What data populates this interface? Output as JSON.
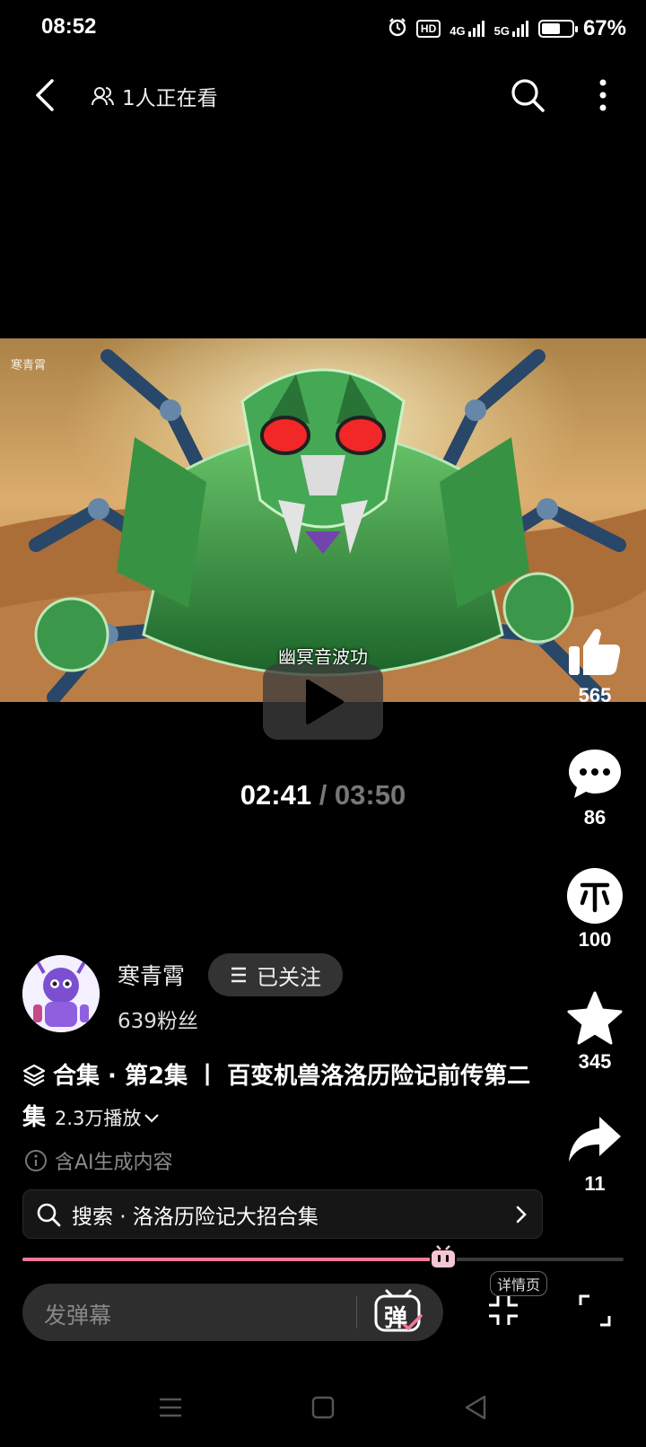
{
  "status_bar": {
    "time": "08:52",
    "hd_label": "HD",
    "net1": "4G",
    "net2": "5G",
    "battery_percent": "67%",
    "battery_level": 0.67
  },
  "nav": {
    "watching": "1人正在看"
  },
  "video": {
    "watermark": "寒青霄",
    "subtitle": "幽冥音波功",
    "current_time": "02:41",
    "separator": " / ",
    "total_time": "03:50",
    "progress": 0.7
  },
  "actions": {
    "like_count": "565",
    "comment_count": "86",
    "coin_count": "100",
    "favorite_count": "345",
    "share_count": "11"
  },
  "uploader": {
    "name": "寒青霄",
    "follow_label": "已关注",
    "fans": "639粉丝"
  },
  "video_info": {
    "title": "合集 · 第2集 丨 百变机兽洛洛历险记前传第二集",
    "plays": "2.3万播放",
    "ai_note": "含AI生成内容"
  },
  "search": {
    "label": "搜索 · 洛洛历险记大招合集"
  },
  "bottom": {
    "danmaku_placeholder": "发弹幕",
    "danmaku_toggle": "弹",
    "details_label": "详情页"
  },
  "colors": {
    "accent_pink": "#f07a9a",
    "background": "#000000"
  }
}
